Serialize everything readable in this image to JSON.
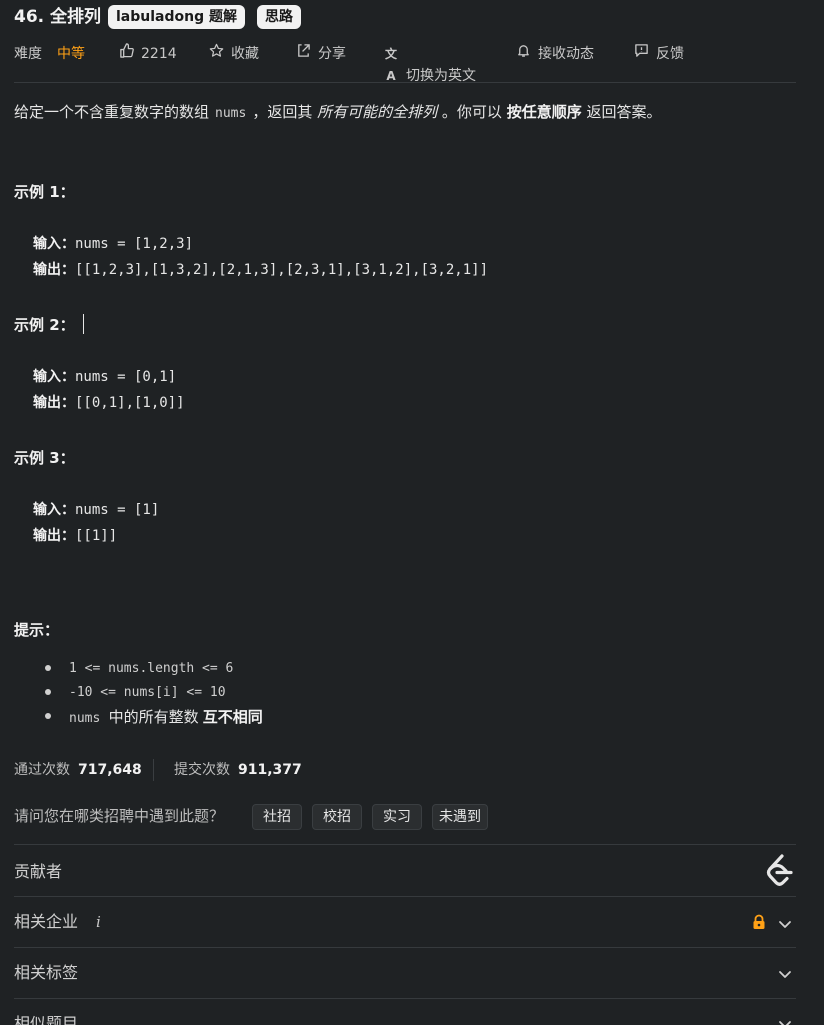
{
  "title": "46. 全排列",
  "tags": [
    "labuladong 题解",
    "思路"
  ],
  "meta": {
    "difficulty_label": "难度",
    "difficulty_value": "中等",
    "likes": "2214",
    "favorite": "收藏",
    "share": "分享",
    "translate": "切换为英文",
    "notify": "接收动态",
    "feedback": "反馈"
  },
  "description": {
    "p1": "给定一个不含重复数字的数组",
    "code": "nums",
    "p2": "，返回其",
    "italic": "所有可能的全排列",
    "p3": "。你可以",
    "bold": "按任意顺序",
    "p4": "返回答案。"
  },
  "examples": [
    {
      "title": "示例 1：",
      "input_label": "输入：",
      "input": "nums = [1,2,3]",
      "output_label": "输出：",
      "output": "[[1,2,3],[1,3,2],[2,1,3],[2,3,1],[3,1,2],[3,2,1]]"
    },
    {
      "title": "示例 2：",
      "input_label": "输入：",
      "input": "nums = [0,1]",
      "output_label": "输出：",
      "output": "[[0,1],[1,0]]"
    },
    {
      "title": "示例 3：",
      "input_label": "输入：",
      "input": "nums = [1]",
      "output_label": "输出：",
      "output": "[[1]]"
    }
  ],
  "hints": {
    "title": "提示：",
    "items": [
      "1 <= nums.length <= 6",
      "-10 <= nums[i] <= 10"
    ],
    "last_code": "nums",
    "last_text1": "中的所有整数",
    "last_bold": "互不相同"
  },
  "stats": {
    "accepted_label": "通过次数",
    "accepted_value": "717,648",
    "submitted_label": "提交次数",
    "submitted_value": "911,377"
  },
  "survey": {
    "question": "请问您在哪类招聘中遇到此题？",
    "options": [
      "社招",
      "校招",
      "实习",
      "未遇到"
    ]
  },
  "sections": {
    "contributors": "贡献者",
    "companies": "相关企业",
    "tags": "相关标签",
    "similar": "相似题目"
  },
  "colors": {
    "accent": "#ffa116",
    "background": "#1f2224"
  },
  "icons": [
    "thumb-up-icon",
    "star-icon",
    "share-icon",
    "translate-icon",
    "bell-icon",
    "feedback-icon",
    "leetcode-logo-icon",
    "lock-icon",
    "chevron-down-icon",
    "info-icon"
  ]
}
